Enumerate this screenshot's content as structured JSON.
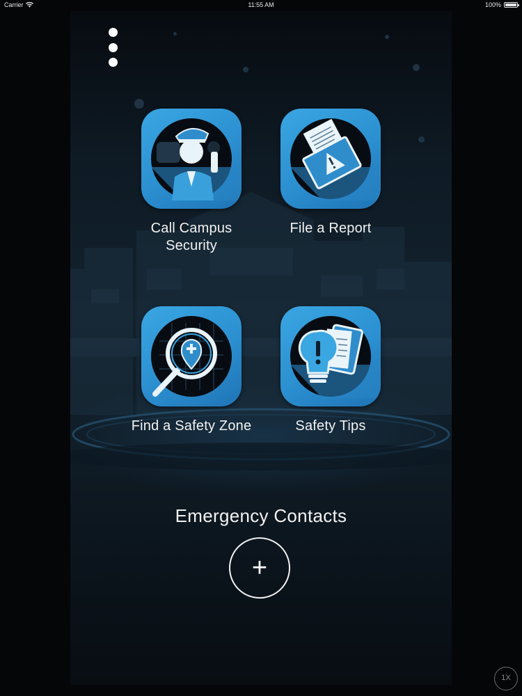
{
  "status_bar": {
    "carrier": "Carrier",
    "time": "11:55 AM",
    "battery_percent": "100%",
    "icons": [
      "wifi-icon",
      "battery-icon"
    ]
  },
  "menu": {
    "icon": "more-vertical-icon"
  },
  "tiles": [
    {
      "label": "Call Campus Security",
      "icon": "security-officer-icon"
    },
    {
      "label": "File a Report",
      "icon": "report-folder-warning-icon"
    },
    {
      "label": "Find a Safety Zone",
      "icon": "map-search-pin-icon"
    },
    {
      "label": "Safety Tips",
      "icon": "lightbulb-tips-icon"
    }
  ],
  "emergency_contacts": {
    "title": "Emergency Contacts",
    "add_symbol": "+"
  },
  "playback": {
    "speed_label": "1X"
  },
  "colors": {
    "tile_blue": "#2b8fd0",
    "tile_blue_light": "#3aa6e2",
    "background_dark": "#0e1a24",
    "text": "#f2f2f2"
  }
}
